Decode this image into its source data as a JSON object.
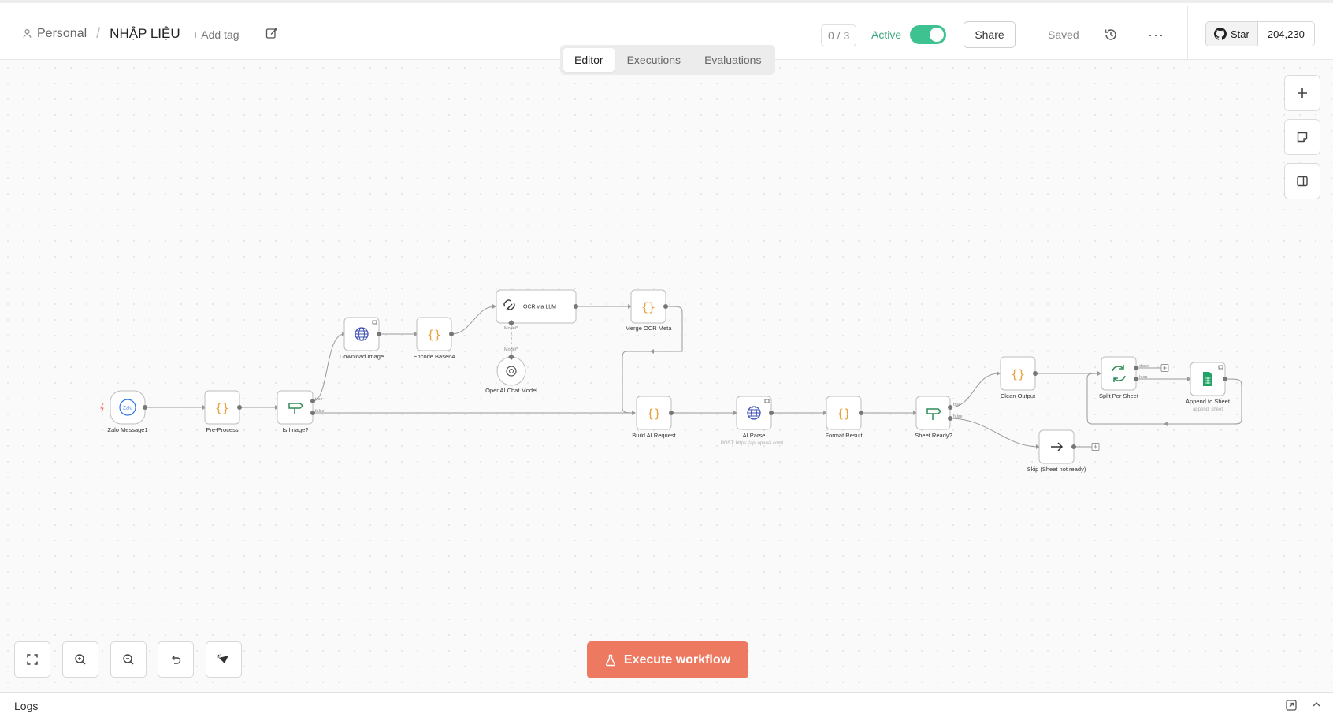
{
  "breadcrumb": {
    "project": "Personal",
    "separator": "/",
    "workflow_name": "NHẬP LIỆU"
  },
  "header": {
    "add_tag": "+ Add tag",
    "counter": "0 / 3",
    "active_label": "Active",
    "share_label": "Share",
    "saved_label": "Saved",
    "more_label": "···",
    "github_star_label": "Star",
    "github_star_count": "204,230"
  },
  "tabs": [
    {
      "label": "Editor",
      "active": true
    },
    {
      "label": "Executions",
      "active": false
    },
    {
      "label": "Evaluations",
      "active": false
    }
  ],
  "canvas_controls": {
    "execute_label": "Execute workflow"
  },
  "logs": {
    "label": "Logs"
  },
  "colors": {
    "accent": "#ee7961",
    "toggle_on": "#3ec28f",
    "active_text": "#3aa87e",
    "code_icon": "#e6a23c",
    "http_icon": "#3f51b5",
    "if_icon": "#2e8b57"
  },
  "icons": {
    "project": "person-icon",
    "rename": "edit-icon",
    "history": "history-icon",
    "github": "github-icon",
    "add_node": "plus-icon",
    "sticky": "sticky-note-icon",
    "panel": "sidebar-panel-icon",
    "fit": "fit-view-icon",
    "zoom_in": "zoom-in-icon",
    "zoom_out": "zoom-out-icon",
    "reset": "undo-icon",
    "tidy": "tidy-up-icon",
    "execute": "flask-icon"
  },
  "workflow": {
    "nodes": [
      {
        "id": "zalo",
        "label": "Zalo Message1",
        "icon_text": "Zalo"
      },
      {
        "id": "pre",
        "label": "Pre-Process"
      },
      {
        "id": "isimg",
        "label": "Is Image?"
      },
      {
        "id": "dl",
        "label": "Download Image"
      },
      {
        "id": "enc",
        "label": "Encode Base64"
      },
      {
        "id": "ocr",
        "label": "OCR via LLM"
      },
      {
        "id": "model",
        "label": "OpenAI Chat Model"
      },
      {
        "id": "merge",
        "label": "Merge OCR Meta"
      },
      {
        "id": "build",
        "label": "Build AI Request"
      },
      {
        "id": "parse",
        "label": "AI Parse",
        "sub": "POST: https://api.openai.com/..."
      },
      {
        "id": "fmt",
        "label": "Format Result"
      },
      {
        "id": "sheetready",
        "label": "Sheet Ready?"
      },
      {
        "id": "clean",
        "label": "Clean Output"
      },
      {
        "id": "split",
        "label": "Split Per Sheet"
      },
      {
        "id": "append",
        "label": "Append to Sheet",
        "sub": "append: sheet"
      },
      {
        "id": "skip",
        "label": "Skip (Sheet not ready)"
      }
    ],
    "edge_labels": {
      "true": "true",
      "false": "false",
      "done": "done",
      "loop": "loop",
      "model": "Model*"
    }
  }
}
